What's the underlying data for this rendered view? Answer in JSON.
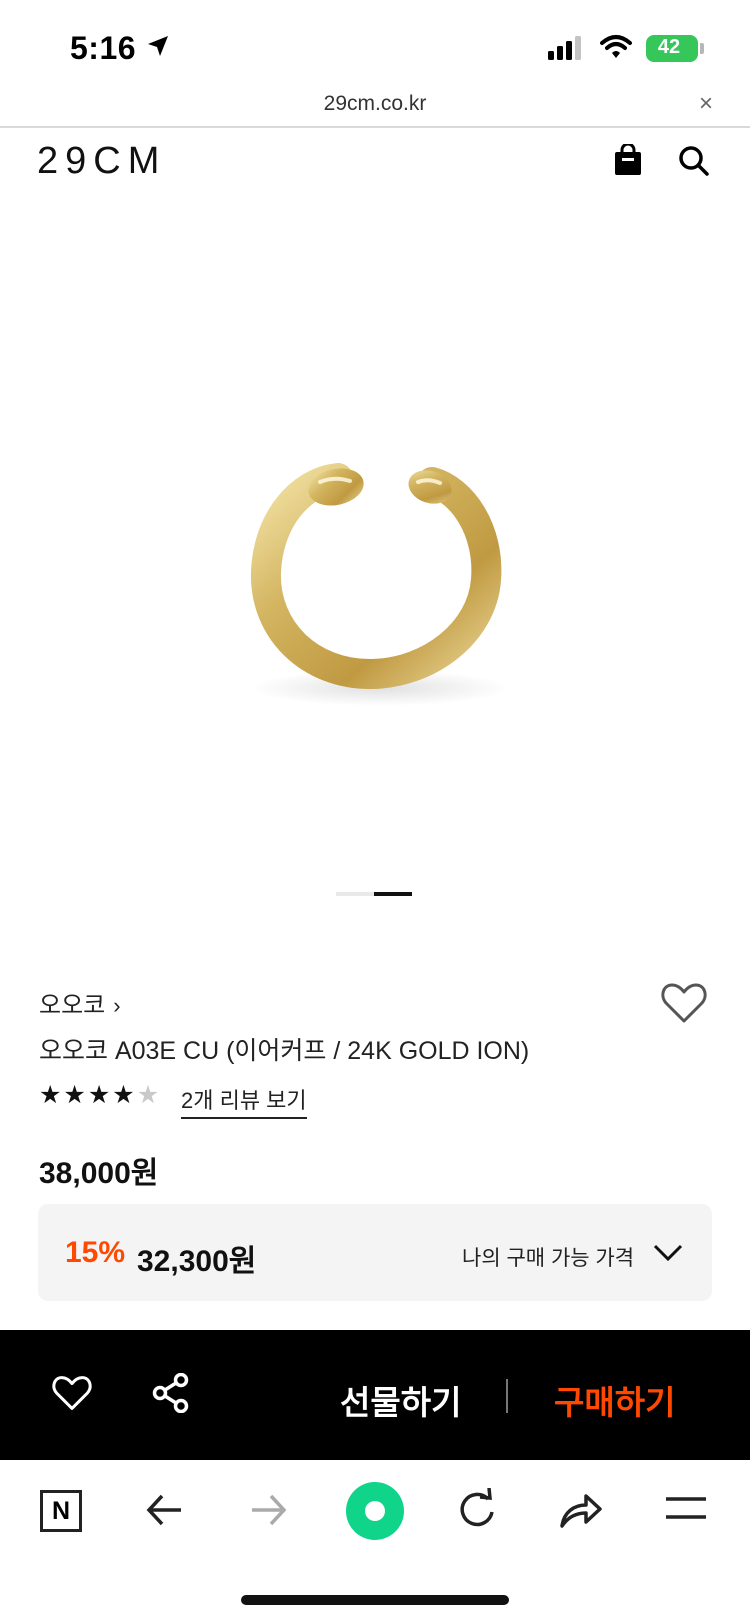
{
  "status_bar": {
    "time": "5:16",
    "battery": "42"
  },
  "browser": {
    "url": "29cm.co.kr",
    "close": "×"
  },
  "header": {
    "logo": "29CM"
  },
  "product": {
    "image_index": 2,
    "image_count": 2,
    "brand": "오오코",
    "brand_chevron": "›",
    "title": "오오코 A03E CU (이어커프 / 24K GOLD ION)",
    "rating": 4,
    "rating_max": 5,
    "review_link": "2개 리뷰 보기",
    "price": "38,000원",
    "discount_percent": "15%",
    "discount_price": "32,300원",
    "my_price_label": "나의 구매 가능 가격"
  },
  "actions": {
    "gift": "선물하기",
    "buy": "구매하기"
  },
  "colors": {
    "accent": "#ff4800",
    "action_bar": "#000000",
    "naver_green": "#0fd489"
  }
}
